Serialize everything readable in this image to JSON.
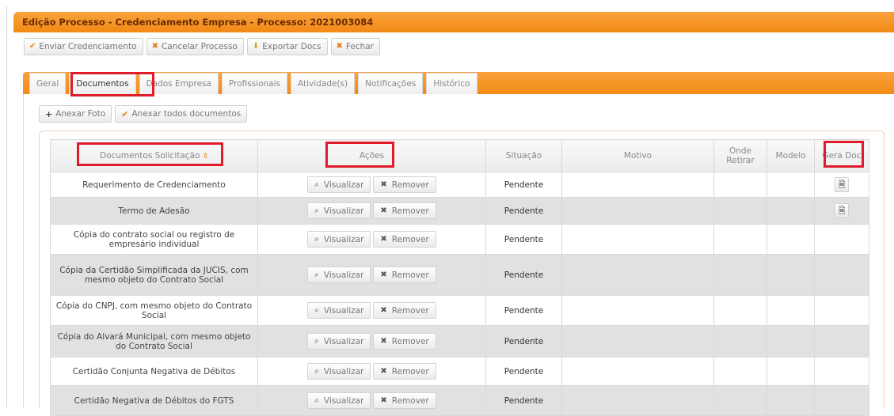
{
  "window": {
    "title": "Edição Processo - Credenciamento Empresa - Processo: 2021003084"
  },
  "toolbar": {
    "buttons": [
      {
        "icon": "check-icon",
        "label": "Enviar Credenciamento"
      },
      {
        "icon": "close-icon",
        "label": "Cancelar Processo"
      },
      {
        "icon": "download-icon",
        "label": "Exportar Docs"
      },
      {
        "icon": "close-icon",
        "label": "Fechar"
      }
    ]
  },
  "tabs": [
    {
      "label": "Geral",
      "active": false
    },
    {
      "label": "Documentos",
      "active": true
    },
    {
      "label": "Dados Empresa",
      "active": false
    },
    {
      "label": "Profissionais",
      "active": false
    },
    {
      "label": "Atividade(s)",
      "active": false
    },
    {
      "label": "Notificações",
      "active": false
    },
    {
      "label": "Histórico",
      "active": false
    }
  ],
  "attach": {
    "add_photo_label": "Anexar Foto",
    "attach_all_label": "Anexar todos documentos"
  },
  "table": {
    "headers": {
      "documento": "Documentos Solicitação",
      "acoes": "Ações",
      "situacao": "Situação",
      "motivo": "Motivo",
      "onde_retirar": "Onde Retirar",
      "modelo": "Modelo",
      "gera_doc": "Gera Doc"
    },
    "view_label": "Visualizar",
    "remove_label": "Remover",
    "rows": [
      {
        "name": "Requerimento de Credenciamento",
        "status": "Pendente",
        "motivo": "",
        "onde": "",
        "modelo": "",
        "gera_doc": true
      },
      {
        "name": "Termo de Adesão",
        "status": "Pendente",
        "motivo": "",
        "onde": "",
        "modelo": "",
        "gera_doc": true
      },
      {
        "name": "Cópia do contrato social ou registro de empresário individual",
        "status": "Pendente",
        "motivo": "",
        "onde": "",
        "modelo": "",
        "gera_doc": false
      },
      {
        "name": "Cópia da Certidão Simplificada da JUCIS, com mesmo objeto do Contrato Social",
        "status": "Pendente",
        "motivo": "",
        "onde": "",
        "modelo": "",
        "gera_doc": false
      },
      {
        "name": "Cópia do CNPJ, com mesmo objeto do Contrato Social",
        "status": "Pendente",
        "motivo": "",
        "onde": "",
        "modelo": "",
        "gera_doc": false
      },
      {
        "name": "Cópia do Alvará Municipal, com mesmo objeto do Contrato Social",
        "status": "Pendente",
        "motivo": "",
        "onde": "",
        "modelo": "",
        "gera_doc": false
      },
      {
        "name": "Certidão Conjunta Negativa de Débitos",
        "status": "Pendente",
        "motivo": "",
        "onde": "",
        "modelo": "",
        "gera_doc": false
      },
      {
        "name": "Certidão Negativa de Débitos do FGTS",
        "status": "Pendente",
        "motivo": "",
        "onde": "",
        "modelo": "",
        "gera_doc": false
      }
    ]
  },
  "colors": {
    "accent_orange": "#f28a15",
    "highlight_red": "#e01b2a",
    "row_alt": "#e1e1e1"
  }
}
